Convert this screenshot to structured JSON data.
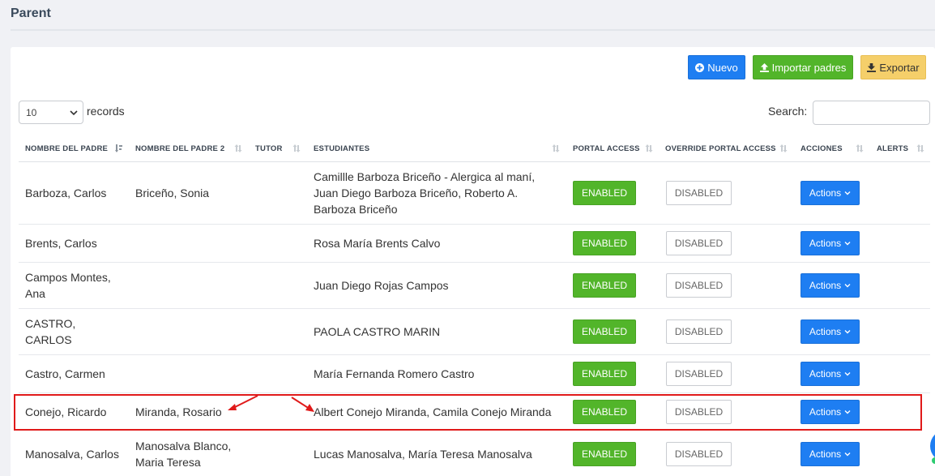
{
  "page": {
    "title": "Parent"
  },
  "toolbar": {
    "new_label": "Nuevo",
    "import_label": "Importar padres",
    "export_label": "Exportar"
  },
  "table_controls": {
    "page_length": "10",
    "records_label": "records",
    "search_label": "Search:",
    "search_value": ""
  },
  "columns": [
    "NOMBRE DEL PADRE",
    "NOMBRE DEL PADRE 2",
    "TUTOR",
    "ESTUDIANTES",
    "PORTAL ACCESS",
    "OVERRIDE PORTAL ACCESS",
    "ACCIONES",
    "ALERTS"
  ],
  "rows": [
    {
      "padre": "Barboza, Carlos",
      "padre2": "Briceño, Sonia",
      "tutor": "",
      "estudiantes": "Camillle Barboza Briceño - Alergica al maní, Juan Diego Barboza Briceño, Roberto A. Barboza Briceño",
      "portal": "ENABLED",
      "override": "DISABLED",
      "acciones": "Actions"
    },
    {
      "padre": "Brents, Carlos",
      "padre2": "",
      "tutor": "",
      "estudiantes": "Rosa María Brents Calvo",
      "portal": "ENABLED",
      "override": "DISABLED",
      "acciones": "Actions"
    },
    {
      "padre": "Campos Montes, Ana",
      "padre2": "",
      "tutor": "",
      "estudiantes": "Juan Diego Rojas Campos",
      "portal": "ENABLED",
      "override": "DISABLED",
      "acciones": "Actions"
    },
    {
      "padre": "CASTRO, CARLOS",
      "padre2": "",
      "tutor": "",
      "estudiantes": "PAOLA CASTRO MARIN",
      "portal": "ENABLED",
      "override": "DISABLED",
      "acciones": "Actions"
    },
    {
      "padre": "Castro, Carmen",
      "padre2": "",
      "tutor": "",
      "estudiantes": "María Fernanda Romero Castro",
      "portal": "ENABLED",
      "override": "DISABLED",
      "acciones": "Actions"
    },
    {
      "padre": "Conejo, Ricardo",
      "padre2": "Miranda, Rosario",
      "tutor": "",
      "estudiantes": "Albert Conejo Miranda, Camila Conejo Miranda",
      "portal": "ENABLED",
      "override": "DISABLED",
      "acciones": "Actions"
    },
    {
      "padre": "Manosalva, Carlos",
      "padre2": "Manosalva Blanco, Maria Teresa",
      "tutor": "",
      "estudiantes": "Lucas Manosalva, María Teresa Manosalva",
      "portal": "ENABLED",
      "override": "DISABLED",
      "acciones": "Actions"
    }
  ],
  "icons": {
    "new": "plus-circle-icon",
    "import": "upload-icon",
    "export": "download-icon",
    "sort": "sort-icon",
    "chevron": "chevron-down-icon"
  },
  "colors": {
    "primary": "#1e7ef2",
    "success": "#52b52a",
    "warning": "#f5cf6a",
    "annotation": "#e01a1a"
  }
}
